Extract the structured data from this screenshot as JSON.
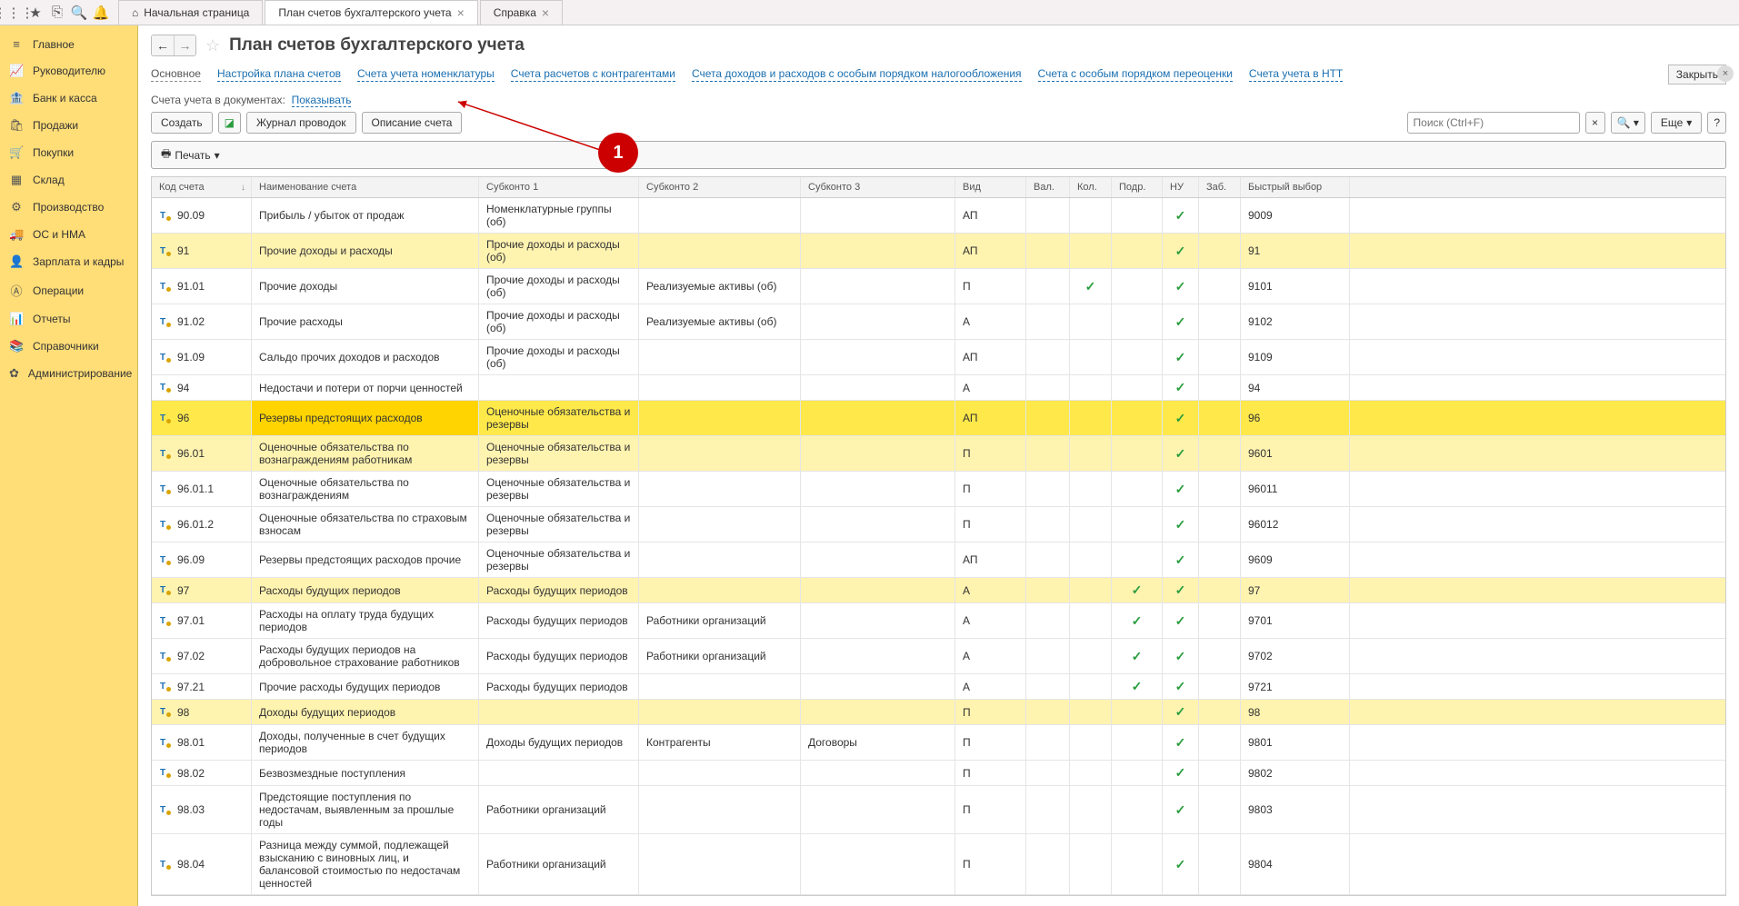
{
  "topbar": {
    "icons": [
      "apps-icon",
      "star-icon",
      "clipboard-icon",
      "search-icon",
      "bell-icon"
    ]
  },
  "tabs": [
    {
      "label": "Начальная страница",
      "icon": "home-icon",
      "closable": false
    },
    {
      "label": "План счетов бухгалтерского учета",
      "closable": true,
      "active": true
    },
    {
      "label": "Справка",
      "closable": true
    }
  ],
  "sidebar": [
    {
      "label": "Главное",
      "icon": "≡"
    },
    {
      "label": "Руководителю",
      "icon": "📈"
    },
    {
      "label": "Банк и касса",
      "icon": "🏦"
    },
    {
      "label": "Продажи",
      "icon": "🛍"
    },
    {
      "label": "Покупки",
      "icon": "🛒"
    },
    {
      "label": "Склад",
      "icon": "▦"
    },
    {
      "label": "Производство",
      "icon": "⚙"
    },
    {
      "label": "ОС и НМА",
      "icon": "🚚"
    },
    {
      "label": "Зарплата и кадры",
      "icon": "👤"
    },
    {
      "label": "Операции",
      "icon": "Ⓐ"
    },
    {
      "label": "Отчеты",
      "icon": "📊"
    },
    {
      "label": "Справочники",
      "icon": "📚"
    },
    {
      "label": "Администрирование",
      "icon": "✿"
    }
  ],
  "page": {
    "title": "План счетов бухгалтерского учета",
    "close_label": "Закрыть"
  },
  "subtabs": [
    {
      "label": "Основное",
      "active": true
    },
    {
      "label": "Настройка плана счетов"
    },
    {
      "label": "Счета учета номенклатуры"
    },
    {
      "label": "Счета расчетов с контрагентами"
    },
    {
      "label": "Счета доходов и расходов с особым порядком налогообложения"
    },
    {
      "label": "Счета с особым порядком переоценки"
    },
    {
      "label": "Счета учета в НТТ"
    }
  ],
  "docline": {
    "label": "Счета учета в документах:",
    "link": "Показывать"
  },
  "toolbar": {
    "create": "Создать",
    "journal": "Журнал проводок",
    "desc": "Описание счета",
    "search_placeholder": "Поиск (Ctrl+F)",
    "more": "Еще"
  },
  "print_label": "Печать",
  "columns": [
    "Код счета",
    "Наименование счета",
    "Субконто 1",
    "Субконто 2",
    "Субконто 3",
    "Вид",
    "Вал.",
    "Кол.",
    "Подр.",
    "НУ",
    "Заб.",
    "Быстрый выбор"
  ],
  "rows": [
    {
      "code": "90.09",
      "name": "Прибыль / убыток от продаж",
      "s1": "Номенклатурные группы (об)",
      "s2": "",
      "s3": "",
      "vid": "АП",
      "val": "",
      "kol": "",
      "podr": "",
      "nu": true,
      "zab": "",
      "quick": "9009"
    },
    {
      "code": "91",
      "name": "Прочие доходы и расходы",
      "s1": "Прочие доходы и расходы (об)",
      "s2": "",
      "s3": "",
      "vid": "АП",
      "val": "",
      "kol": "",
      "podr": "",
      "nu": true,
      "zab": "",
      "quick": "91",
      "yellow": true
    },
    {
      "code": "91.01",
      "name": "Прочие доходы",
      "s1": "Прочие доходы и расходы (об)",
      "s2": "Реализуемые активы (об)",
      "s3": "",
      "vid": "П",
      "val": "",
      "kol": true,
      "podr": "",
      "nu": true,
      "zab": "",
      "quick": "9101"
    },
    {
      "code": "91.02",
      "name": "Прочие расходы",
      "s1": "Прочие доходы и расходы (об)",
      "s2": "Реализуемые активы (об)",
      "s3": "",
      "vid": "А",
      "val": "",
      "kol": "",
      "podr": "",
      "nu": true,
      "zab": "",
      "quick": "9102"
    },
    {
      "code": "91.09",
      "name": "Сальдо прочих доходов и расходов",
      "s1": "Прочие доходы и расходы (об)",
      "s2": "",
      "s3": "",
      "vid": "АП",
      "val": "",
      "kol": "",
      "podr": "",
      "nu": true,
      "zab": "",
      "quick": "9109"
    },
    {
      "code": "94",
      "name": "Недостачи и потери от порчи ценностей",
      "s1": "",
      "s2": "",
      "s3": "",
      "vid": "А",
      "val": "",
      "kol": "",
      "podr": "",
      "nu": true,
      "zab": "",
      "quick": "94"
    },
    {
      "code": "96",
      "name": "Резервы предстоящих расходов",
      "s1": "Оценочные обязательства и резервы",
      "s2": "",
      "s3": "",
      "vid": "АП",
      "val": "",
      "kol": "",
      "podr": "",
      "nu": true,
      "zab": "",
      "quick": "96",
      "selected": true
    },
    {
      "code": "96.01",
      "name": "Оценочные обязательства по вознаграждениям работникам",
      "s1": "Оценочные обязательства и резервы",
      "s2": "",
      "s3": "",
      "vid": "П",
      "val": "",
      "kol": "",
      "podr": "",
      "nu": true,
      "zab": "",
      "quick": "9601",
      "yellow": true
    },
    {
      "code": "96.01.1",
      "name": "Оценочные обязательства по вознаграждениям",
      "s1": "Оценочные обязательства и резервы",
      "s2": "",
      "s3": "",
      "vid": "П",
      "val": "",
      "kol": "",
      "podr": "",
      "nu": true,
      "zab": "",
      "quick": "96011"
    },
    {
      "code": "96.01.2",
      "name": "Оценочные обязательства по страховым взносам",
      "s1": "Оценочные обязательства и резервы",
      "s2": "",
      "s3": "",
      "vid": "П",
      "val": "",
      "kol": "",
      "podr": "",
      "nu": true,
      "zab": "",
      "quick": "96012"
    },
    {
      "code": "96.09",
      "name": "Резервы предстоящих расходов прочие",
      "s1": "Оценочные обязательства и резервы",
      "s2": "",
      "s3": "",
      "vid": "АП",
      "val": "",
      "kol": "",
      "podr": "",
      "nu": true,
      "zab": "",
      "quick": "9609"
    },
    {
      "code": "97",
      "name": "Расходы будущих периодов",
      "s1": "Расходы будущих периодов",
      "s2": "",
      "s3": "",
      "vid": "А",
      "val": "",
      "kol": "",
      "podr": true,
      "nu": true,
      "zab": "",
      "quick": "97",
      "yellow": true
    },
    {
      "code": "97.01",
      "name": "Расходы на оплату труда будущих периодов",
      "s1": "Расходы будущих периодов",
      "s2": "Работники организаций",
      "s3": "",
      "vid": "А",
      "val": "",
      "kol": "",
      "podr": true,
      "nu": true,
      "zab": "",
      "quick": "9701"
    },
    {
      "code": "97.02",
      "name": "Расходы будущих периодов на добровольное страхование работников",
      "s1": "Расходы будущих периодов",
      "s2": "Работники организаций",
      "s3": "",
      "vid": "А",
      "val": "",
      "kol": "",
      "podr": true,
      "nu": true,
      "zab": "",
      "quick": "9702"
    },
    {
      "code": "97.21",
      "name": "Прочие расходы будущих периодов",
      "s1": "Расходы будущих периодов",
      "s2": "",
      "s3": "",
      "vid": "А",
      "val": "",
      "kol": "",
      "podr": true,
      "nu": true,
      "zab": "",
      "quick": "9721"
    },
    {
      "code": "98",
      "name": "Доходы будущих периодов",
      "s1": "",
      "s2": "",
      "s3": "",
      "vid": "П",
      "val": "",
      "kol": "",
      "podr": "",
      "nu": true,
      "zab": "",
      "quick": "98",
      "yellow": true
    },
    {
      "code": "98.01",
      "name": "Доходы, полученные в счет будущих периодов",
      "s1": "Доходы будущих периодов",
      "s2": "Контрагенты",
      "s3": "Договоры",
      "vid": "П",
      "val": "",
      "kol": "",
      "podr": "",
      "nu": true,
      "zab": "",
      "quick": "9801"
    },
    {
      "code": "98.02",
      "name": "Безвозмездные поступления",
      "s1": "",
      "s2": "",
      "s3": "",
      "vid": "П",
      "val": "",
      "kol": "",
      "podr": "",
      "nu": true,
      "zab": "",
      "quick": "9802"
    },
    {
      "code": "98.03",
      "name": "Предстоящие поступления по недостачам, выявленным за прошлые годы",
      "s1": "Работники организаций",
      "s2": "",
      "s3": "",
      "vid": "П",
      "val": "",
      "kol": "",
      "podr": "",
      "nu": true,
      "zab": "",
      "quick": "9803"
    },
    {
      "code": "98.04",
      "name": "Разница между суммой, подлежащей взысканию с виновных лиц, и балансовой стоимостью по недостачам ценностей",
      "s1": "Работники организаций",
      "s2": "",
      "s3": "",
      "vid": "П",
      "val": "",
      "kol": "",
      "podr": "",
      "nu": true,
      "zab": "",
      "quick": "9804"
    }
  ],
  "callout": {
    "label": "1"
  }
}
